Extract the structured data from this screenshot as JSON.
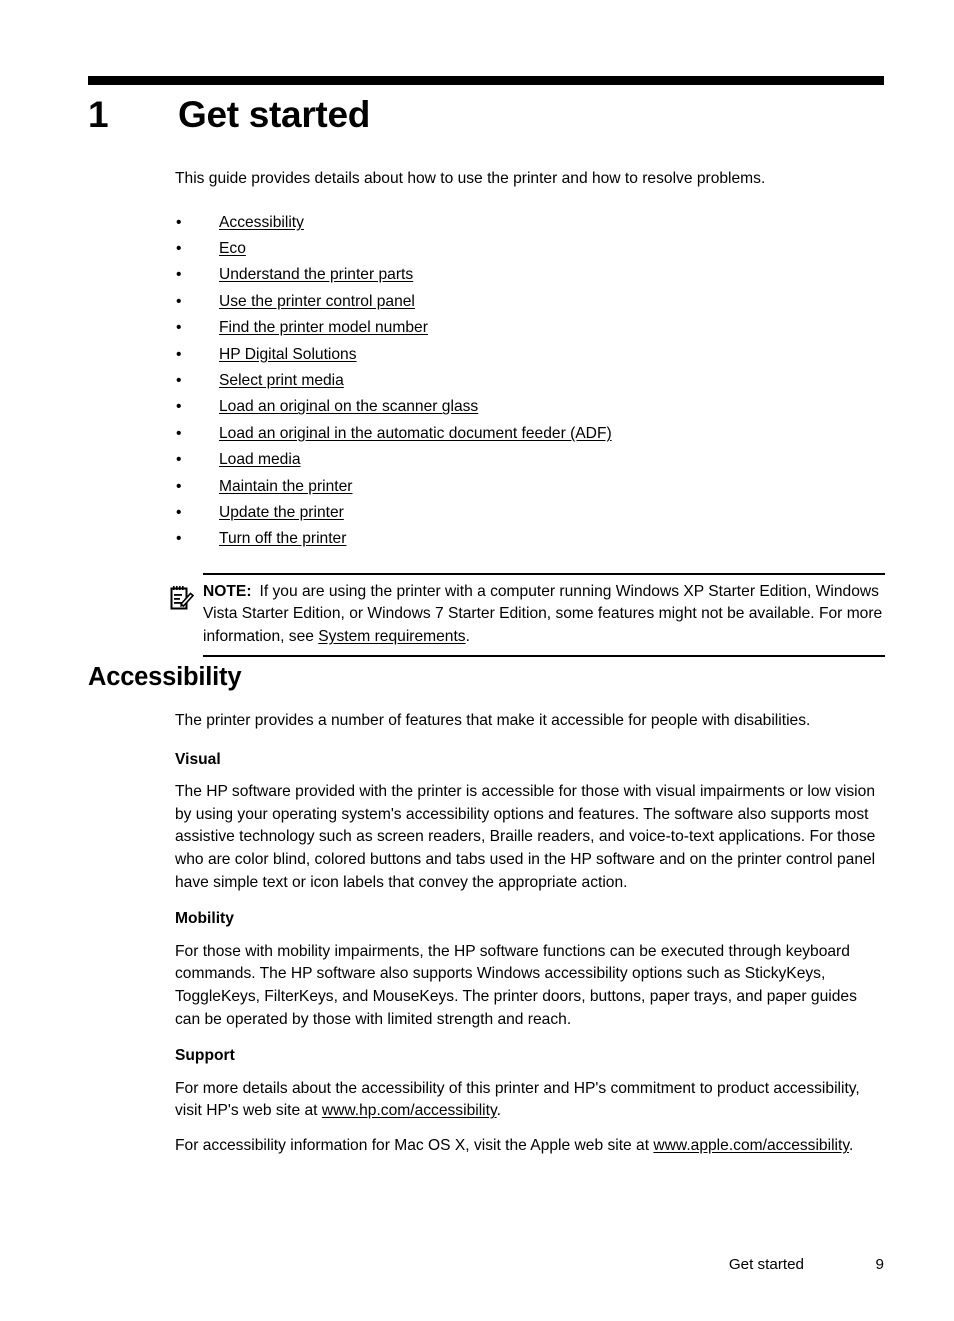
{
  "chapter": {
    "number": "1",
    "title": "Get started"
  },
  "intro": {
    "paragraph": "This guide provides details about how to use the printer and how to resolve problems."
  },
  "toc": {
    "bullet_glyph": "•",
    "items": [
      {
        "label": "Accessibility"
      },
      {
        "label": "Eco"
      },
      {
        "label": "Understand the printer parts"
      },
      {
        "label": "Use the printer control panel"
      },
      {
        "label": "Find the printer model number"
      },
      {
        "label": "HP Digital Solutions"
      },
      {
        "label": "Select print media"
      },
      {
        "label": "Load an original on the scanner glass"
      },
      {
        "label": "Load an original in the automatic document feeder (ADF)"
      },
      {
        "label": "Load media"
      },
      {
        "label": "Maintain the printer"
      },
      {
        "label": "Update the printer"
      },
      {
        "label": "Turn off the printer"
      }
    ]
  },
  "note": {
    "icon": "note-pencil-icon",
    "label": "NOTE:",
    "text_before_link": "If you are using the printer with a computer running Windows XP Starter Edition, Windows Vista Starter Edition, or Windows 7 Starter Edition, some features might not be available. For more information, see ",
    "link": "System requirements",
    "text_after_link": "."
  },
  "section": {
    "heading": "Accessibility",
    "intro": "The printer provides a number of features that make it accessible for people with disabilities.",
    "visual": {
      "subhead": "Visual",
      "text": "The HP software provided with the printer is accessible for those with visual impairments or low vision by using your operating system's accessibility options and features. The software also supports most assistive technology such as screen readers, Braille readers, and voice-to-text applications. For those who are color blind, colored buttons and tabs used in the HP software and on the printer control panel have simple text or icon labels that convey the appropriate action."
    },
    "mobility": {
      "subhead": "Mobility",
      "text": "For those with mobility impairments, the HP software functions can be executed through keyboard commands. The HP software also supports Windows accessibility options such as StickyKeys, ToggleKeys, FilterKeys, and MouseKeys. The printer doors, buttons, paper trays, and paper guides can be operated by those with limited strength and reach."
    },
    "support": {
      "subhead": "Support",
      "para1_before": "For more details about the accessibility of this printer and HP's commitment to product accessibility, visit HP's web site at ",
      "para1_link": "www.hp.com/accessibility",
      "para1_after": ".",
      "para2_before": "For accessibility information for Mac OS X, visit the Apple web site at ",
      "para2_link": "www.apple.com/accessibility",
      "para2_after": "."
    }
  },
  "footer": {
    "chapter_label": "Get started",
    "page_number": "9"
  }
}
